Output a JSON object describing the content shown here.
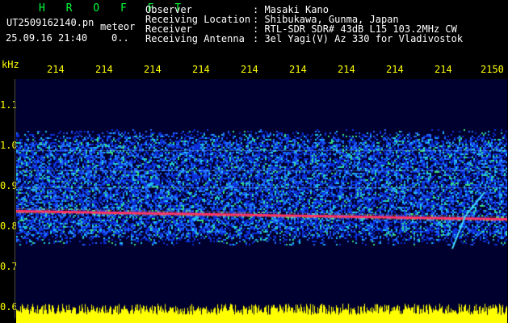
{
  "header": {
    "station": "H R O F F T",
    "filename": "UT2509162140.pn",
    "mode": "meteor",
    "datetime": "25.09.16 21:40",
    "counter": "0..",
    "fields": [
      {
        "label": "Observer",
        "value": ": Masaki Kano"
      },
      {
        "label": "Receiving Location",
        "value": ": Shibukawa, Gunma, Japan"
      },
      {
        "label": "Receiver",
        "value": ": RTL-SDR SDR# 43dB L15 103.2MHz CW"
      },
      {
        "label": "Receiving Antenna",
        "value": ": 3el Yagi(V) Az 330 for Vladivostok"
      }
    ]
  },
  "axes": {
    "y_unit": "kHz",
    "y_ticks": [
      "1.1",
      "1.0",
      "0.9",
      "0.8",
      "0.7",
      "0.6"
    ],
    "x_ticks": [
      "214",
      "214",
      "214",
      "214",
      "214",
      "214",
      "214",
      "214",
      "214",
      "2150"
    ]
  },
  "colors": {
    "background": "#000000",
    "noise_floor": "#00002e",
    "strong_signal": "#ff3366",
    "audio_level": "#ffff00"
  }
}
